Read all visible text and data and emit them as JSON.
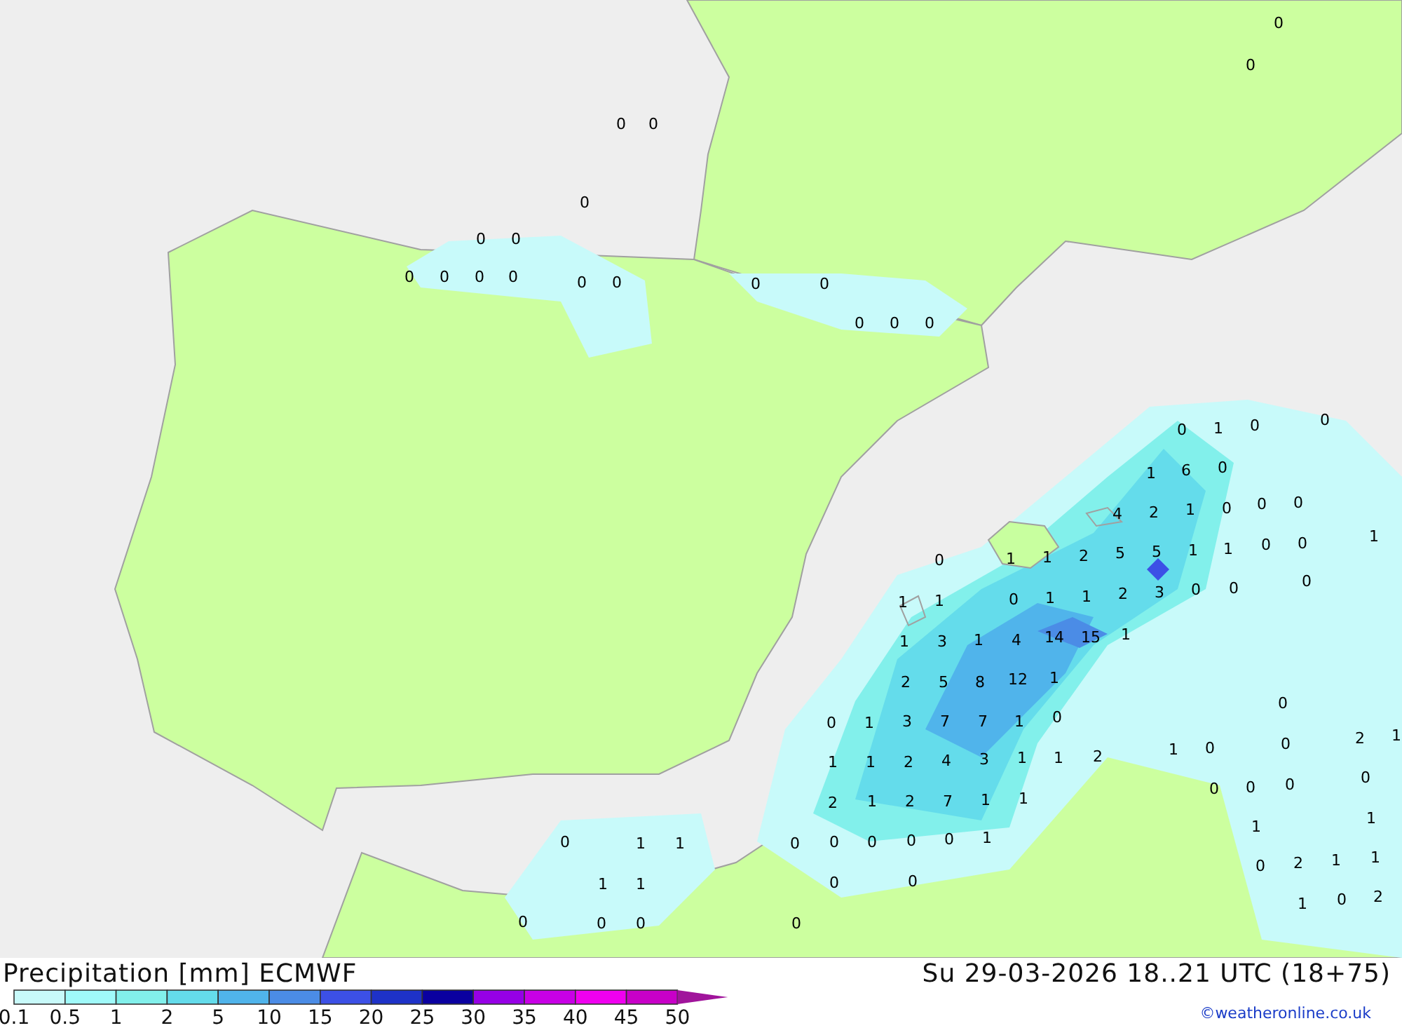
{
  "map": {
    "values": [
      "0",
      "0",
      "0",
      "0",
      "0",
      "0",
      "0",
      "0",
      "0",
      "0",
      "0",
      "0",
      "0",
      "0",
      "0",
      "0",
      "0",
      "0",
      "0",
      "1",
      "0",
      "0",
      "1",
      "6",
      "0",
      "4",
      "2",
      "1",
      "0",
      "0",
      "0",
      "1",
      "0",
      "1",
      "1",
      "2",
      "5",
      "5",
      "1",
      "1",
      "0",
      "0",
      "1",
      "1",
      "0",
      "1",
      "1",
      "2",
      "3",
      "0",
      "0",
      "0",
      "1",
      "3",
      "1",
      "4",
      "14",
      "15",
      "1",
      "2",
      "5",
      "8",
      "12",
      "1",
      "0",
      "0",
      "1",
      "3",
      "7",
      "7",
      "1",
      "0",
      "2",
      "1",
      "0",
      "1",
      "0",
      "1",
      "1",
      "2",
      "4",
      "3",
      "1",
      "1",
      "2",
      "0",
      "0",
      "0",
      "0",
      "2",
      "1",
      "2",
      "7",
      "1",
      "1",
      "1",
      "1",
      "0",
      "0",
      "0",
      "0",
      "0",
      "1",
      "0",
      "2",
      "1",
      "1",
      "0",
      "0",
      "1",
      "0",
      "2",
      "0",
      "0",
      "1",
      "1",
      "1",
      "1",
      "0",
      "0",
      "0"
    ]
  },
  "legend": {
    "title": "Precipitation [mm] ECMWF",
    "valid_time": "Su 29-03-2026 18..21 UTC (18+75)",
    "steps": [
      {
        "color": "#c8fafa"
      },
      {
        "color": "#a0fafa"
      },
      {
        "color": "#82f0eb"
      },
      {
        "color": "#64dceb"
      },
      {
        "color": "#50b4eb"
      },
      {
        "color": "#4b8ce6"
      },
      {
        "color": "#3c50e6"
      },
      {
        "color": "#1e32c8"
      },
      {
        "color": "#0a00a0"
      },
      {
        "color": "#9600e6"
      },
      {
        "color": "#c800e6"
      },
      {
        "color": "#f000f0"
      },
      {
        "color": "#c800c8"
      },
      {
        "kind": "arrow",
        "color": "#a0149b"
      }
    ],
    "ticks": [
      "0.1",
      "0.5",
      "1",
      "2",
      "5",
      "10",
      "15",
      "20",
      "25",
      "30",
      "35",
      "40",
      "45",
      "50"
    ],
    "credit": "©weatheronline.co.uk"
  }
}
